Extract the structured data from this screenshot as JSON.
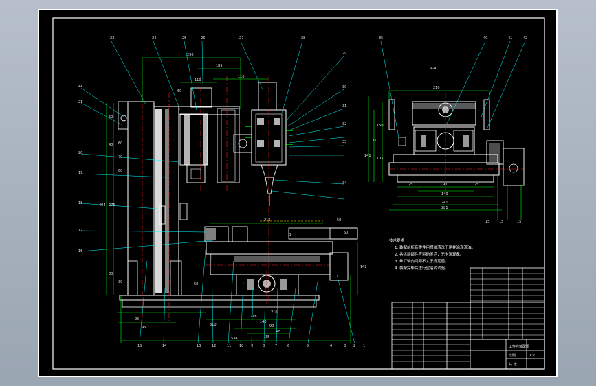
{
  "drawing": {
    "colors": {
      "background": "#000000",
      "frame": "#ffffff",
      "geometry": "#ffffff",
      "dimension": "#00ff00",
      "centerline": "#ff2020",
      "leader": "#00ffff",
      "hatch": "#ffffff",
      "accent": "#ffff00"
    },
    "main_view": {
      "balloons": [
        "23",
        "24",
        "25",
        "26",
        "27",
        "28",
        "29",
        "30",
        "31",
        "32",
        "33",
        "34",
        "22",
        "21",
        "20",
        "19",
        "18",
        "17",
        "16",
        "15",
        "14",
        "13",
        "12",
        "11",
        "10",
        "9",
        "8",
        "7",
        "6",
        "5",
        "4",
        "3",
        "2",
        "1"
      ],
      "dims": [
        "296",
        "185",
        "110",
        "110",
        "60",
        "50",
        "40",
        "60",
        "70",
        "60",
        "275",
        "404",
        "30",
        "30",
        "216",
        "50",
        "50",
        "142",
        "95",
        "216",
        "310",
        "95",
        "90",
        "48",
        "35",
        "534",
        "216",
        "140",
        "50"
      ],
      "section_mark": "B"
    },
    "side_view": {
      "title": "A-A",
      "balloons": [
        "35",
        "40",
        "41",
        "42"
      ],
      "dims": [
        "210",
        "150",
        "135",
        "141",
        "105",
        "25",
        "90",
        "25",
        "140",
        "241",
        "281",
        "15",
        "15",
        "15"
      ]
    },
    "tech_notes": {
      "heading": "技术要求",
      "lines": [
        "1. 装配前所有零件用煤油清洗干净并涂润滑油。",
        "2. 各运动部件应运动灵活，无卡滞现象。",
        "3. 丝杠轴向间隙不大于规定值。",
        "4. 装配完毕后进行空运转试验。"
      ]
    },
    "title_block": {
      "scale_label": "比例",
      "scale_value": "1:2",
      "sheet_label": "共 张",
      "drawing_no": "工作台装配图"
    }
  }
}
